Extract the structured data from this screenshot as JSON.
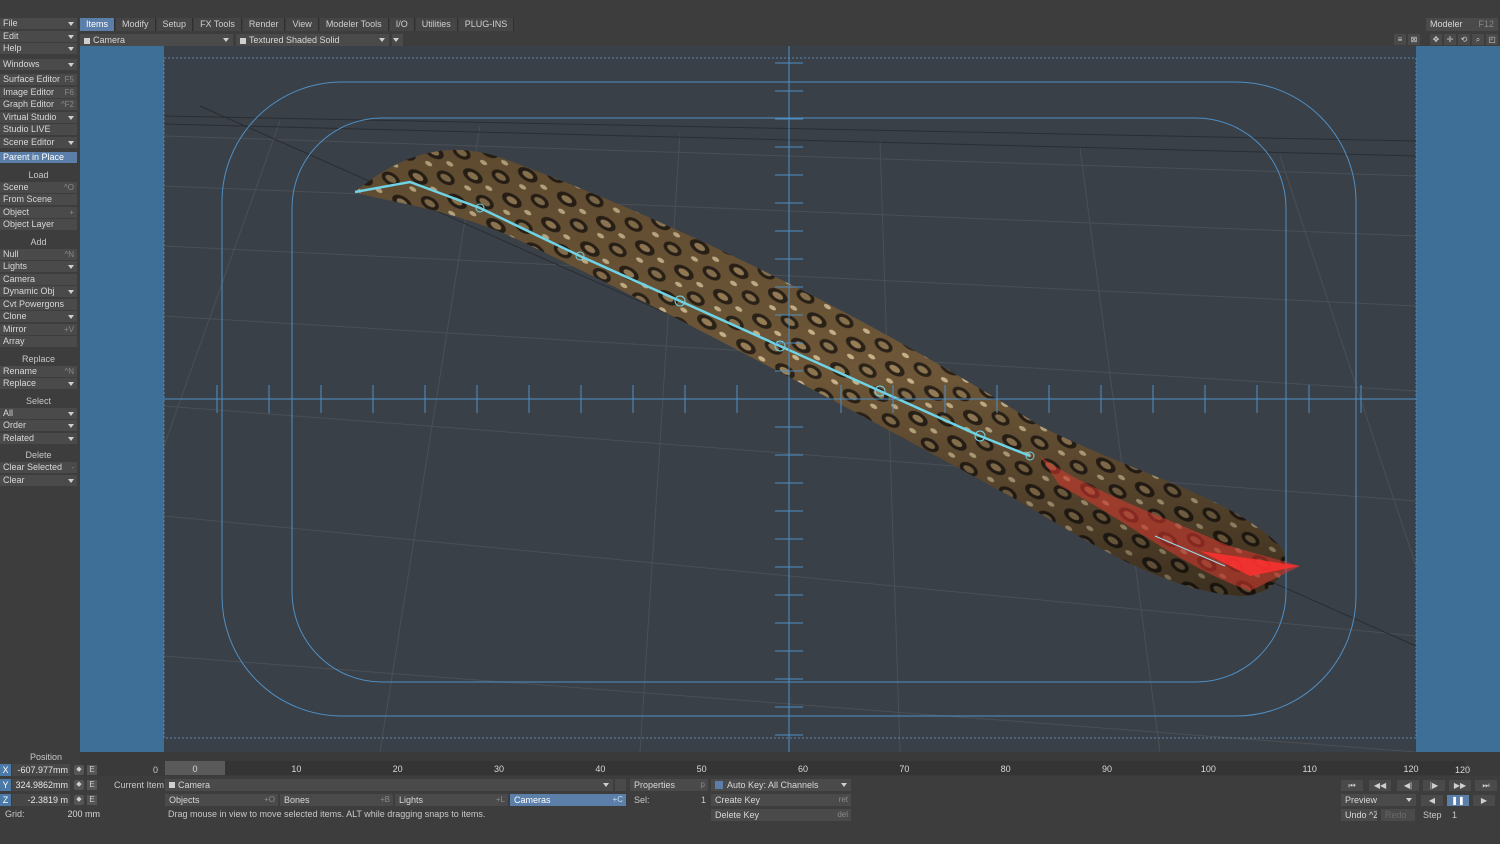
{
  "tabs": [
    "Items",
    "Modify",
    "Setup",
    "FX Tools",
    "Render",
    "View",
    "Modeler Tools",
    "I/O",
    "Utilities",
    "PLUG-INS"
  ],
  "modeler": {
    "label": "Modeler",
    "shortcut": "F12"
  },
  "left_panel": {
    "top": [
      {
        "label": "File",
        "arrow": true
      },
      {
        "label": "Edit",
        "arrow": true
      },
      {
        "label": "Help",
        "arrow": true
      }
    ],
    "windows": {
      "label": "Windows",
      "arrow": true
    },
    "editors": [
      {
        "label": "Surface Editor",
        "shortcut": "F5"
      },
      {
        "label": "Image Editor",
        "shortcut": "F6"
      },
      {
        "label": "Graph Editor",
        "shortcut": "^F2"
      },
      {
        "label": "Virtual Studio",
        "arrow": true
      },
      {
        "label": "Studio LIVE"
      },
      {
        "label": "Scene Editor",
        "arrow": true
      }
    ],
    "parent_in_place": "Parent in Place",
    "load_header": "Load",
    "load": [
      {
        "label": "Scene",
        "shortcut": "^O"
      },
      {
        "label": "From Scene"
      },
      {
        "label": "Object",
        "shortcut": "+"
      },
      {
        "label": "Object Layer"
      }
    ],
    "add_header": "Add",
    "add": [
      {
        "label": "Null",
        "shortcut": "^N"
      },
      {
        "label": "Lights",
        "arrow": true
      },
      {
        "label": "Camera"
      },
      {
        "label": "Dynamic Obj",
        "arrow": true
      },
      {
        "label": "Cvt Powergons"
      },
      {
        "label": "Clone",
        "arrow": true
      },
      {
        "label": "Mirror",
        "shortcut": "+V"
      },
      {
        "label": "Array"
      }
    ],
    "replace_header": "Replace",
    "replace": [
      {
        "label": "Rename",
        "shortcut": "^N"
      },
      {
        "label": "Replace",
        "arrow": true
      }
    ],
    "select_header": "Select",
    "select": [
      {
        "label": "All",
        "arrow": true
      },
      {
        "label": "Order",
        "arrow": true
      },
      {
        "label": "Related",
        "arrow": true
      }
    ],
    "delete_header": "Delete",
    "delete": [
      {
        "label": "Clear Selected",
        "shortcut": "-"
      },
      {
        "label": "Clear",
        "arrow": true
      }
    ]
  },
  "viewport": {
    "camera_select": "Camera",
    "render_mode": "Textured Shaded Solid"
  },
  "timeline": {
    "start": "0",
    "end": "120",
    "ticks": [
      "0",
      "10",
      "20",
      "30",
      "40",
      "50",
      "60",
      "70",
      "80",
      "90",
      "100",
      "110",
      "120"
    ]
  },
  "bottom": {
    "position_label": "Position",
    "x": {
      "axis": "X",
      "value": "-607.977mm"
    },
    "y": {
      "axis": "Y",
      "value": "324.9862mm"
    },
    "z": {
      "axis": "Z",
      "value": "-2.3819 m"
    },
    "e": "E",
    "grid_label": "Grid:",
    "grid_value": "200 mm",
    "frame_value": "0",
    "current_item_label": "Current Item",
    "current_item": "Camera",
    "objects": {
      "label": "Objects",
      "shortcut": "+O"
    },
    "bones": {
      "label": "Bones",
      "shortcut": "+B"
    },
    "lights": {
      "label": "Lights",
      "shortcut": "+L"
    },
    "cameras": {
      "label": "Cameras",
      "shortcut": "+C"
    },
    "properties": {
      "label": "Properties",
      "shortcut": "p"
    },
    "sel_label": "Sel:",
    "sel_value": "1",
    "auto_key": "Auto Key: All Channels",
    "create_key": {
      "label": "Create Key",
      "shortcut": "ret"
    },
    "delete_key": {
      "label": "Delete Key",
      "shortcut": "del"
    },
    "hint": "Drag mouse in view to move selected items. ALT while dragging snaps to items.",
    "preview": "Preview",
    "undo": "Undo ^Z",
    "redo": "Redo",
    "step_label": "Step",
    "step_value": "1"
  }
}
